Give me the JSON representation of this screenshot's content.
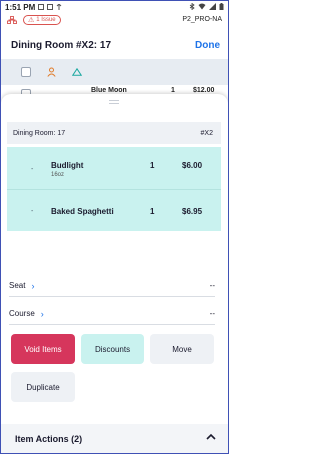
{
  "status_bar": {
    "time": "1:51 PM",
    "icons": [
      "notification-icon",
      "notification-icon",
      "upload-icon",
      "bluetooth-icon",
      "wifi-icon",
      "signal-icon",
      "battery-icon"
    ]
  },
  "app_header": {
    "issue_badge": "1 Issue",
    "device_name": "P2_PRO-NA"
  },
  "title_bar": {
    "title": "Dining Room #X2: 17",
    "done_label": "Done"
  },
  "background_row": {
    "name": "Blue Moon",
    "qty": "1",
    "price": "$12.00"
  },
  "sheet": {
    "order_header": {
      "left": "Dining Room: 17",
      "right": "#X2"
    },
    "items": [
      {
        "dash": "-",
        "name": "Budlight",
        "sub": "16oz",
        "qty": "1",
        "price": "$6.00"
      },
      {
        "dash": "-",
        "name": "Baked Spaghetti",
        "sub": "",
        "qty": "1",
        "price": "$6.95"
      }
    ],
    "fields": [
      {
        "label": "Seat",
        "value": "--"
      },
      {
        "label": "Course",
        "value": "--"
      }
    ],
    "buttons": {
      "void": "Void Items",
      "discounts": "Discounts",
      "move": "Move",
      "duplicate": "Duplicate"
    },
    "footer": {
      "label": "Item Actions (2)"
    }
  },
  "colors": {
    "accent": "#1e73e8",
    "void": "#d6365c",
    "selected": "#c9f2ef",
    "issue": "#d9534f"
  }
}
